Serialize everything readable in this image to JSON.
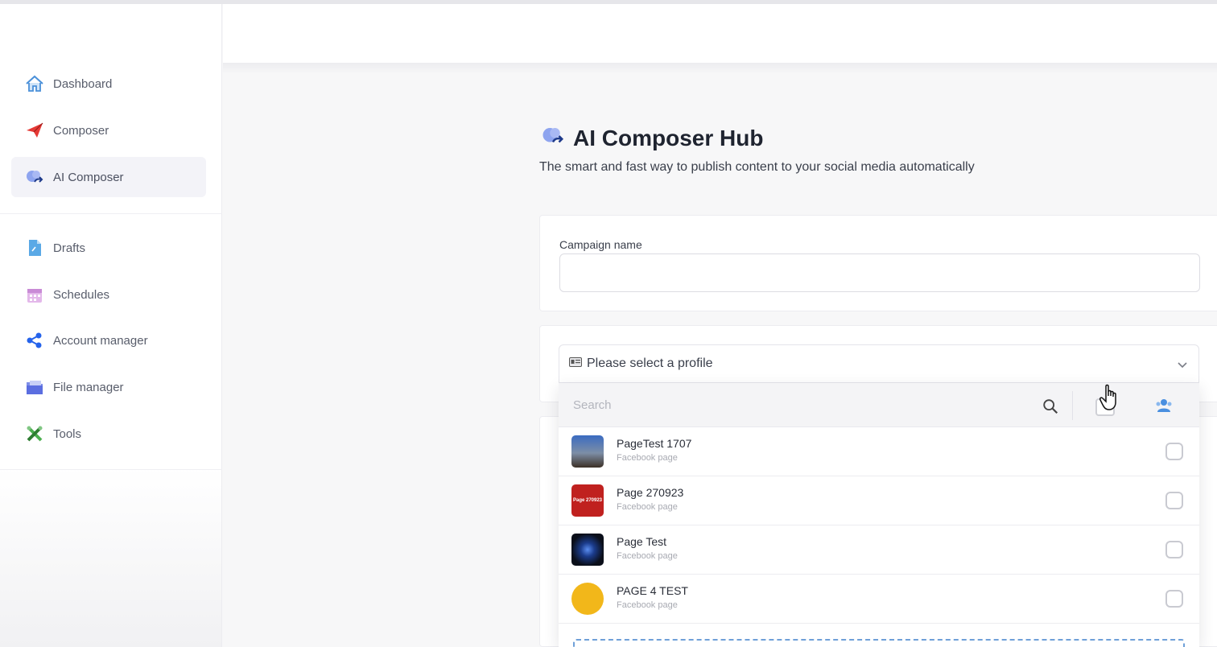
{
  "sidebar": {
    "items": [
      {
        "label": "Dashboard",
        "icon": "home-icon"
      },
      {
        "label": "Composer",
        "icon": "paper-plane-icon"
      },
      {
        "label": "AI Composer",
        "icon": "brain-icon",
        "active": true
      },
      {
        "label": "Drafts",
        "icon": "document-icon"
      },
      {
        "label": "Schedules",
        "icon": "calendar-icon"
      },
      {
        "label": "Account manager",
        "icon": "share-nodes-icon"
      },
      {
        "label": "File manager",
        "icon": "folder-icon"
      },
      {
        "label": "Tools",
        "icon": "tools-icon"
      }
    ]
  },
  "hub": {
    "title": "AI Composer Hub",
    "subtitle": "The smart and fast way to publish content to your social media automatically"
  },
  "campaign": {
    "label": "Campaign name",
    "value": ""
  },
  "profile_select": {
    "placeholder": "Please select a profile",
    "search_placeholder": "Search",
    "pages": [
      {
        "name": "PageTest 1707",
        "type": "Facebook page",
        "avatar_color": "#3a5a8a",
        "checked": false
      },
      {
        "name": "Page 270923",
        "type": "Facebook page",
        "avatar_color": "#c0211f",
        "avatar_text": "Page 270923",
        "checked": false
      },
      {
        "name": "Page Test",
        "type": "Facebook page",
        "avatar_color": "#101623",
        "checked": false
      },
      {
        "name": "PAGE 4 TEST",
        "type": "Facebook page",
        "avatar_color": "#f2b71a",
        "checked": false
      }
    ]
  },
  "colors": {
    "accent": "#3b5bdb",
    "active_bg": "#f3f3f8"
  }
}
